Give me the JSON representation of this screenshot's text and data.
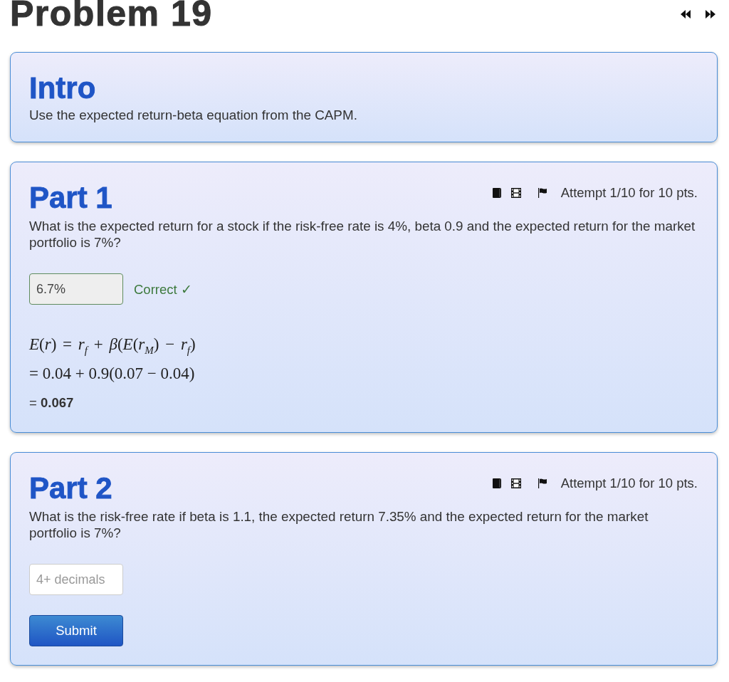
{
  "title": "Problem 19",
  "intro": {
    "heading": "Intro",
    "text": "Use the expected return-beta equation from the CAPM."
  },
  "parts": [
    {
      "heading": "Part 1",
      "attempt": "Attempt 1/10 for 10 pts.",
      "question": "What is the expected return for a stock if the risk-free rate is 4%, beta 0.9 and the expected return for the market portfolio is 7%?",
      "answer": {
        "value": "6.7%",
        "correct": true
      },
      "feedback": "Correct ✓",
      "solution": [
        {
          "kind": "formula",
          "text": "*E*(*r*) = *r*$_{f}$ + *β*(*E*(*r*$_{M}$) − *r*$_{f}$)"
        },
        {
          "kind": "step",
          "text": "= 0.04 + 0.9(0.07 − 0.04)"
        },
        {
          "kind": "result",
          "text": "= **0.067**"
        }
      ]
    },
    {
      "heading": "Part 2",
      "attempt": "Attempt 1/10 for 10 pts.",
      "question": "What is the risk-free rate if beta is 1.1, the expected return 7.35% and the expected return for the market portfolio is 7%?",
      "answer": {
        "placeholder": "4+ decimals",
        "correct": false
      },
      "button": "Submit"
    }
  ]
}
